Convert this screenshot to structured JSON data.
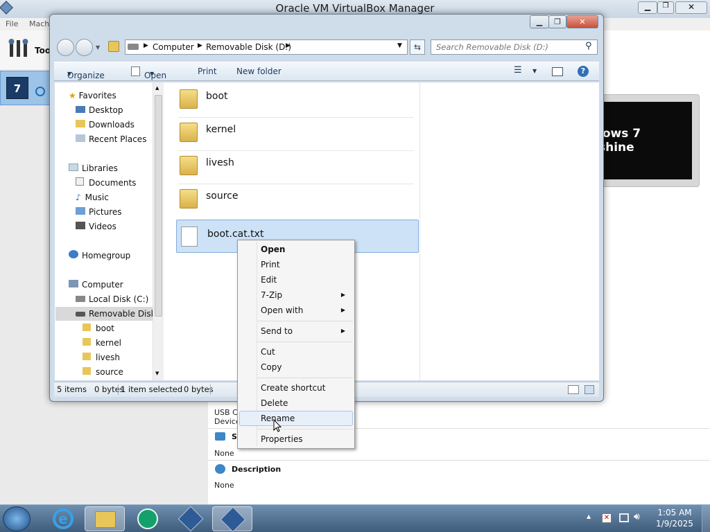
{
  "vbox": {
    "title": "Oracle VM VirtualBox Manager",
    "menu": [
      "File",
      "Mach"
    ],
    "tools_label": "Too",
    "preview_text": "lows 7 shine",
    "usb_lines": [
      "USB Co",
      "Device"
    ],
    "shared_header": "S",
    "none1": "None",
    "description_header": "Description",
    "none2": "None"
  },
  "explorer": {
    "address": [
      "Computer",
      "Removable Disk (D:)"
    ],
    "search_placeholder": "Search Removable Disk (D:)",
    "toolbar": {
      "organize": "Organize",
      "open": "Open",
      "print": "Print",
      "new_folder": "New folder"
    },
    "nav": {
      "favorites": "Favorites",
      "desktop": "Desktop",
      "downloads": "Downloads",
      "recent": "Recent Places",
      "libraries": "Libraries",
      "documents": "Documents",
      "music": "Music",
      "pictures": "Pictures",
      "videos": "Videos",
      "homegroup": "Homegroup",
      "computer": "Computer",
      "local_disk": "Local Disk (C:)",
      "removable": "Removable Disk (",
      "sub_boot": "boot",
      "sub_kernel": "kernel",
      "sub_livesh": "livesh",
      "sub_source": "source"
    },
    "files": [
      {
        "name": "boot",
        "type": "folder"
      },
      {
        "name": "kernel",
        "type": "folder"
      },
      {
        "name": "livesh",
        "type": "folder"
      },
      {
        "name": "source",
        "type": "folder"
      },
      {
        "name": "boot.cat.txt",
        "type": "text-file"
      }
    ],
    "status": {
      "items": "5 items",
      "bytes": "0 bytes",
      "selected": "1 item selected",
      "selected_bytes": "0 bytes"
    }
  },
  "context_menu": {
    "open": "Open",
    "print": "Print",
    "edit": "Edit",
    "zip": "7-Zip",
    "open_with": "Open with",
    "send_to": "Send to",
    "cut": "Cut",
    "copy": "Copy",
    "create_shortcut": "Create shortcut",
    "delete": "Delete",
    "rename": "Rename",
    "properties": "Properties"
  },
  "taskbar": {
    "time": "1:05 AM",
    "date": "1/9/2025"
  }
}
